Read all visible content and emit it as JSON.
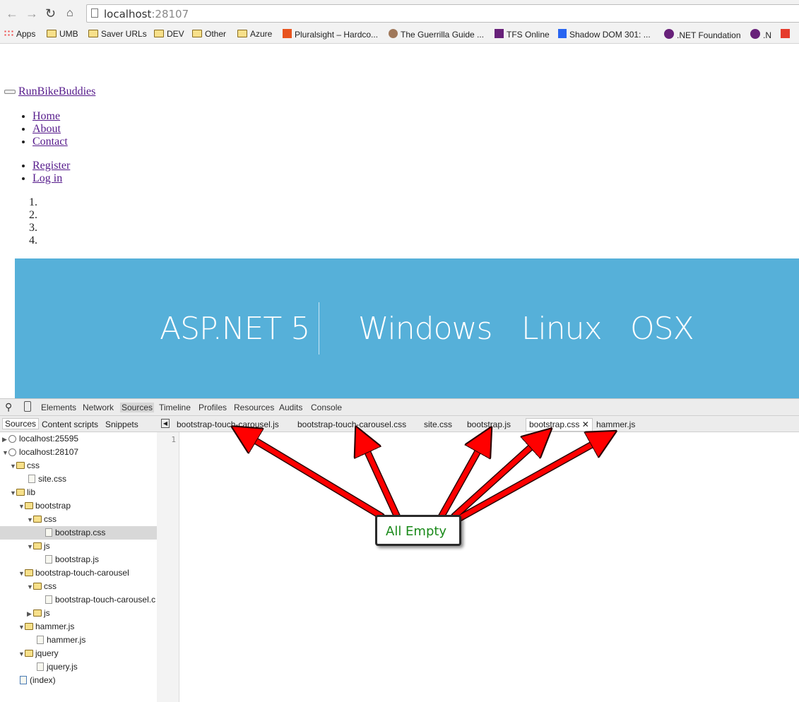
{
  "browser": {
    "url_host": "localhost",
    "url_port": ":28107",
    "bookmarks": [
      {
        "label": "Apps",
        "icon": "apps-grid-icon"
      },
      {
        "label": "UMB",
        "icon": "folder-icon"
      },
      {
        "label": "Saver URLs",
        "icon": "folder-icon"
      },
      {
        "label": "DEV",
        "icon": "folder-icon"
      },
      {
        "label": "Other",
        "icon": "folder-icon"
      },
      {
        "label": "Azure",
        "icon": "folder-icon"
      },
      {
        "label": "Pluralsight – Hardco...",
        "icon": "pluralsight-icon"
      },
      {
        "label": "The Guerrilla Guide ...",
        "icon": "avatar-icon"
      },
      {
        "label": "TFS Online",
        "icon": "visual-studio-icon"
      },
      {
        "label": "Shadow DOM 301: ...",
        "icon": "html5-icon"
      },
      {
        "label": ".NET Foundation",
        "icon": "dotnet-icon"
      },
      {
        "label": ".N",
        "icon": "dotnet-icon"
      }
    ]
  },
  "page": {
    "brand": "RunBikeBuddies",
    "nav": [
      "Home",
      "About",
      "Contact"
    ],
    "account": [
      "Register",
      "Log in"
    ],
    "indicators": [
      "1.",
      "2.",
      "3.",
      "4."
    ],
    "hero": {
      "primary": "ASP.NET 5",
      "items": [
        "Windows",
        "Linux",
        "OSX"
      ]
    }
  },
  "devtools": {
    "tabs": [
      "Elements",
      "Network",
      "Sources",
      "Timeline",
      "Profiles",
      "Resources",
      "Audits",
      "Console"
    ],
    "active_tab": "Sources",
    "sidebar_tabs": [
      "Sources",
      "Content scripts",
      "Snippets"
    ],
    "tree": [
      {
        "label": "localhost:25595",
        "kind": "origin",
        "expanded": false
      },
      {
        "label": "localhost:28107",
        "kind": "origin",
        "expanded": true
      },
      {
        "label": "css",
        "kind": "folder"
      },
      {
        "label": "site.css",
        "kind": "file"
      },
      {
        "label": "lib",
        "kind": "folder"
      },
      {
        "label": "bootstrap",
        "kind": "folder"
      },
      {
        "label": "css",
        "kind": "folder"
      },
      {
        "label": "bootstrap.css",
        "kind": "file",
        "selected": true
      },
      {
        "label": "js",
        "kind": "folder"
      },
      {
        "label": "bootstrap.js",
        "kind": "file"
      },
      {
        "label": "bootstrap-touch-carousel",
        "kind": "folder"
      },
      {
        "label": "css",
        "kind": "folder"
      },
      {
        "label": "bootstrap-touch-carousel.c",
        "kind": "file"
      },
      {
        "label": "js",
        "kind": "folder",
        "expanded": false
      },
      {
        "label": "hammer.js",
        "kind": "folder"
      },
      {
        "label": "hammer.js",
        "kind": "file"
      },
      {
        "label": "jquery",
        "kind": "folder"
      },
      {
        "label": "jquery.js",
        "kind": "file"
      },
      {
        "label": "(index)",
        "kind": "html"
      }
    ],
    "editor_tabs": [
      "bootstrap-touch-carousel.js",
      "bootstrap-touch-carousel.css",
      "site.css",
      "bootstrap.js",
      "bootstrap.css",
      "hammer.js"
    ],
    "active_editor_tab": "bootstrap.css",
    "line_number": "1"
  },
  "annotation": {
    "text": "All Empty",
    "color": "#1a8a1a",
    "arrow_color": "#ff0000"
  },
  "colors": {
    "hero_bg": "#56b0d9",
    "link": "#551a8b"
  }
}
